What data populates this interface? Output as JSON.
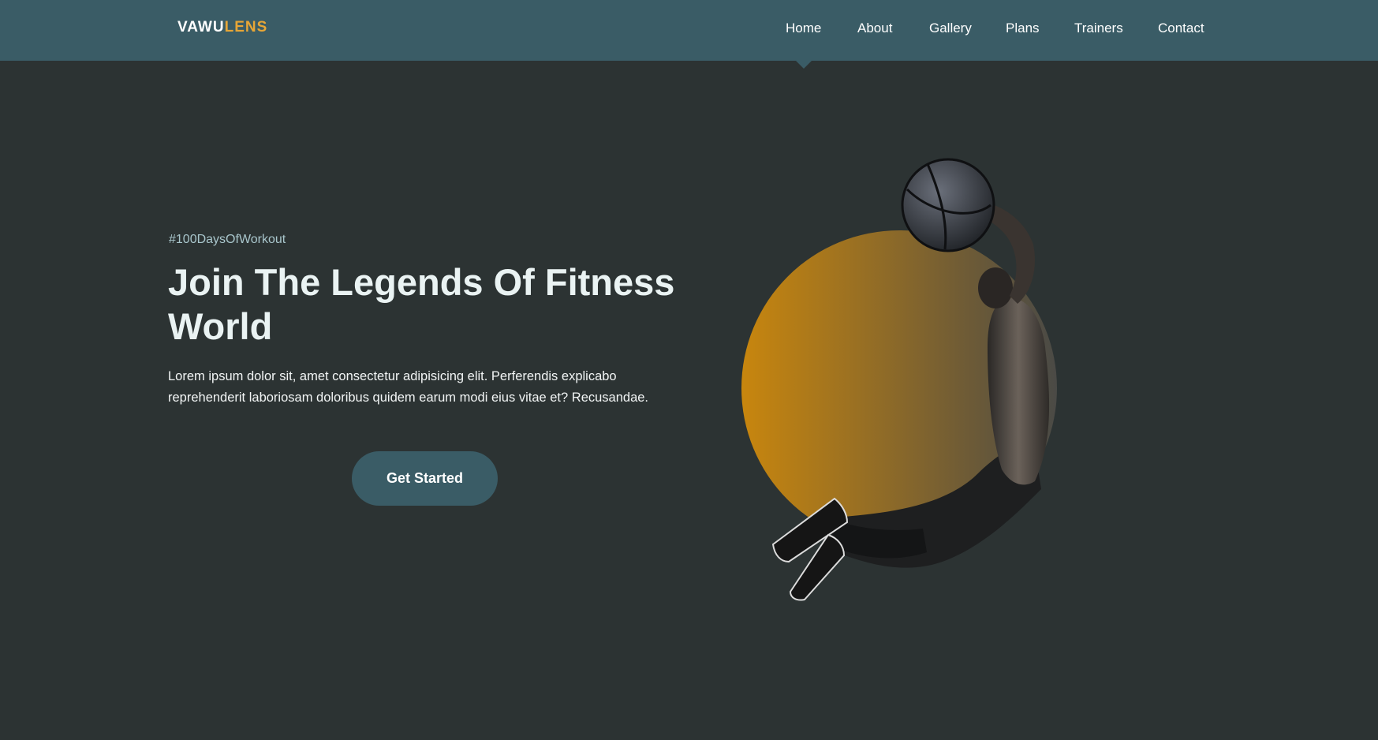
{
  "brand": {
    "name_primary": "VAWU",
    "name_accent": "LENS"
  },
  "nav": {
    "items": [
      {
        "label": "Home",
        "active": true
      },
      {
        "label": "About"
      },
      {
        "label": "Gallery"
      },
      {
        "label": "Plans"
      },
      {
        "label": "Trainers"
      },
      {
        "label": "Contact"
      }
    ]
  },
  "hero": {
    "tagline": "#100DaysOfWorkout",
    "headline": "Join The Legends Of Fitness World",
    "description": "Lorem ipsum dolor sit, amet consectetur adipisicing elit. Perferendis explicabo reprehenderit laboriosam doloribus quidem earum modi eius vitae et? Recusandae.",
    "cta_label": "Get Started"
  },
  "colors": {
    "navbar": "#3a5c66",
    "background": "#2c3333",
    "brand_accent": "#e7a636",
    "circle_gradient_start": "#c8860e",
    "circle_gradient_end": "#4a4a46"
  }
}
